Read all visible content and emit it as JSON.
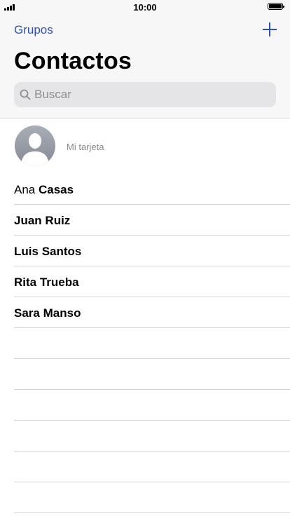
{
  "status_bar": {
    "time": "10:00"
  },
  "nav": {
    "back_label": "Grupos",
    "title": "Contactos",
    "accent_color": "#2c4fc4"
  },
  "search": {
    "placeholder": "Buscar",
    "value": ""
  },
  "my_card": {
    "label": "Mi tarjeta"
  },
  "contacts": [
    {
      "first": "Ana",
      "last": "Casas"
    },
    {
      "first": "Juan",
      "last": "Ruiz"
    },
    {
      "first": "Luis",
      "last": "Santos"
    },
    {
      "first": "Rita",
      "last": "Trueba"
    },
    {
      "first": "Sara",
      "last": "Manso"
    }
  ]
}
